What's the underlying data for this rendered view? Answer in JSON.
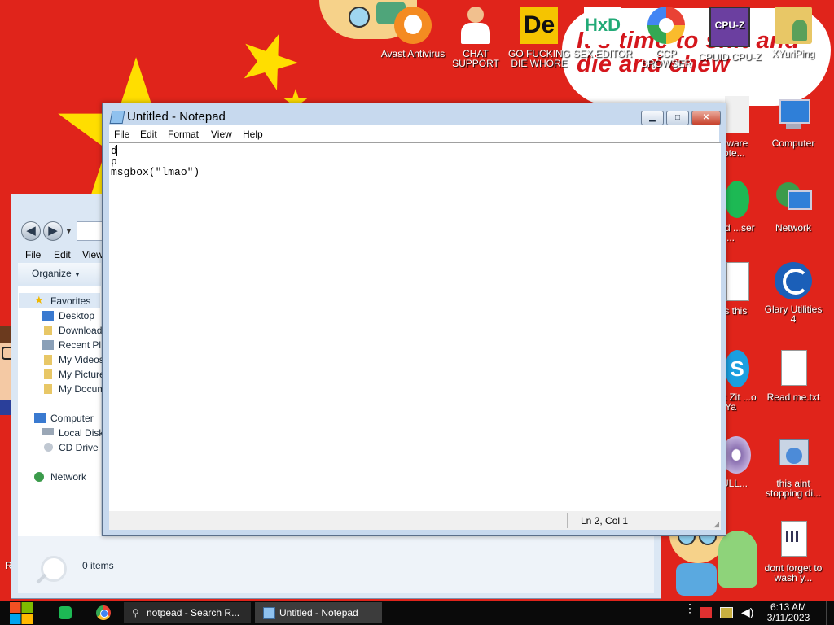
{
  "desktop": {
    "speech_text": "It's time to shit and die and chew",
    "icons_top": [
      {
        "label": "Avast Antivirus",
        "icon": "avast-icon"
      },
      {
        "label": "CHAT SUPPORT",
        "icon": "doctor-icon"
      },
      {
        "label": "GO FUCKING DIE WHORE",
        "icon": "de-icon"
      },
      {
        "label": "SEX EDITOR",
        "icon": "hxd-icon"
      },
      {
        "label": "CCP BROWSER",
        "icon": "chrome-like-icon"
      },
      {
        "label": "CPUID CPU-Z",
        "icon": "cpuz-icon"
      },
      {
        "label": "XYuriPing",
        "icon": "folder-user-icon"
      }
    ],
    "icons_right": [
      {
        "label": "Computer",
        "icon": "computer-icon"
      },
      {
        "label": "Network",
        "icon": "network-icon"
      },
      {
        "label": "Glary Utilities 4",
        "icon": "glary-icon"
      },
      {
        "label": "Read me.txt",
        "icon": "text-file-icon"
      },
      {
        "label": "this aint stopping di...",
        "icon": "installer-icon"
      },
      {
        "label": "dont forget to wash y...",
        "icon": "calendar-file-icon"
      }
    ],
    "icons_partial": [
      {
        "label": "...eware Note...",
        "icon": "partial-app-icon"
      },
      {
        "label": "...sed ...ser ...",
        "icon": "spotify-icon"
      },
      {
        "label": "...is this",
        "icon": "calendar-file-icon"
      },
      {
        "label": "...hat Zit ...o Ya",
        "icon": "skype-icon"
      },
      {
        "label": "...ULL...",
        "icon": "disc-icon"
      }
    ],
    "left_edge_letter": "R"
  },
  "explorer": {
    "menu": [
      "File",
      "Edit",
      "View"
    ],
    "organize_label": "Organize",
    "favorites_label": "Favorites",
    "nav_items": [
      "Desktop",
      "Download",
      "Recent Pl",
      "My Videos",
      "My Picture",
      "My Docum"
    ],
    "computer_label": "Computer",
    "computer_items": [
      "Local Disk",
      "CD Drive"
    ],
    "network_label": "Network",
    "status": "0 items"
  },
  "notepad": {
    "title": "Untitled - Notepad",
    "menu": [
      "File",
      "Edit",
      "Format",
      "View",
      "Help"
    ],
    "text": "d\np\nmsgbox(\"lmao\")",
    "status": "Ln 2, Col 1"
  },
  "taskbar": {
    "items": [
      {
        "label": "notpead - Search R...",
        "icon": "search-icon"
      },
      {
        "label": "Untitled - Notepad",
        "icon": "notepad-icon"
      }
    ],
    "time": "6:13 AM",
    "date": "3/11/2023"
  }
}
